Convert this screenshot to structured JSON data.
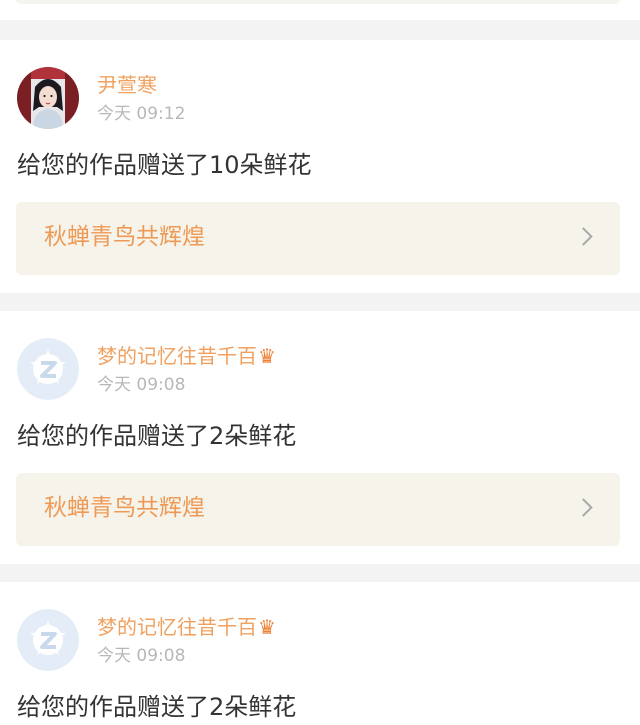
{
  "posts": [
    {
      "user": "尹萱寒",
      "crown": "",
      "time": "今天 09:12",
      "message": "给您的作品赠送了10朵鲜花",
      "work_title": "秋蝉青鸟共辉煌",
      "avatar_icon": "user-photo-avatar"
    },
    {
      "user": "梦的记忆往昔千百",
      "crown": "♛",
      "time": "今天 09:08",
      "message": "给您的作品赠送了2朵鲜花",
      "work_title": "秋蝉青鸟共辉煌",
      "avatar_icon": "default-z-avatar-icon"
    },
    {
      "user": "梦的记忆往昔千百",
      "crown": "♛",
      "time": "今天 09:08",
      "message": "给您的作品赠送了2朵鲜花",
      "work_title": "",
      "avatar_icon": "default-z-avatar-icon"
    }
  ],
  "colors": {
    "name": "#f0a15f",
    "crown": "#ec7f35",
    "link_bg": "#f5f3ea",
    "time": "#b8b8b8"
  }
}
